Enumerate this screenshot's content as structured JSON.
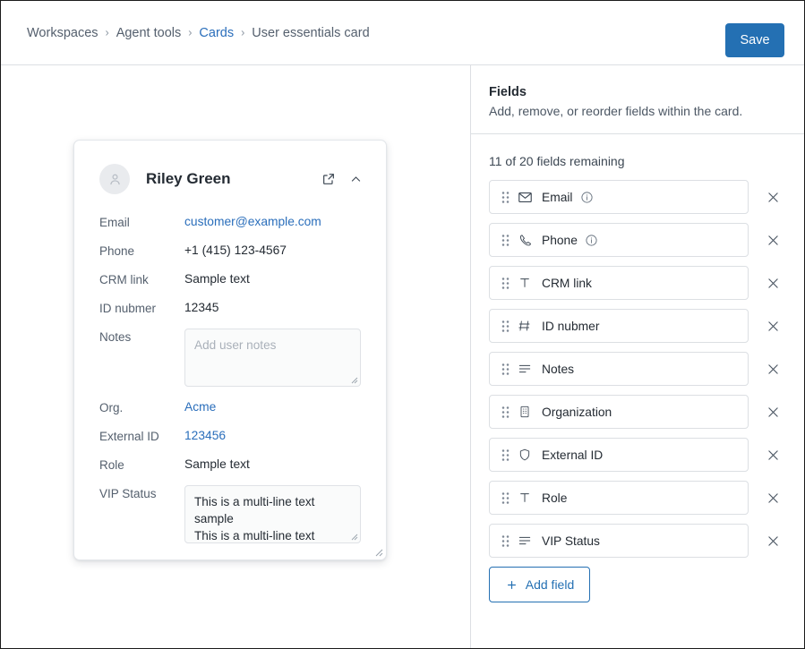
{
  "topbar": {
    "breadcrumb": [
      {
        "label": "Workspaces",
        "link": false
      },
      {
        "label": "Agent tools",
        "link": false
      },
      {
        "label": "Cards",
        "link": true
      },
      {
        "label": "User essentials card",
        "link": false
      }
    ],
    "separator": "›",
    "save_label": "Save"
  },
  "card": {
    "name": "Riley Green",
    "avatar_icon": "person-icon",
    "open_icon": "external-link-icon",
    "collapse_icon": "chevron-up-icon",
    "rows": [
      {
        "label": "Email",
        "value": "customer@example.com",
        "kind": "link"
      },
      {
        "label": "Phone",
        "value": "+1 (415) 123-4567",
        "kind": "text"
      },
      {
        "label": "CRM link",
        "value": "Sample text",
        "kind": "text"
      },
      {
        "label": "ID nubmer",
        "value": "12345",
        "kind": "text"
      },
      {
        "label": "Notes",
        "value": "",
        "kind": "textarea",
        "placeholder": "Add user notes"
      },
      {
        "label": "Org.",
        "value": "Acme",
        "kind": "link"
      },
      {
        "label": "External ID",
        "value": "123456",
        "kind": "link"
      },
      {
        "label": "Role",
        "value": "Sample text",
        "kind": "text"
      },
      {
        "label": "VIP Status",
        "value": "This is a multi-line text sample\nThis is a multi-line text",
        "kind": "textarea",
        "placeholder": ""
      }
    ]
  },
  "panel": {
    "title": "Fields",
    "subtitle": "Add, remove, or reorder fields within the card.",
    "remaining": "11 of 20 fields remaining",
    "drag_icon": "drag-handle-icon",
    "remove_icon": "close-icon",
    "info_icon": "info-icon",
    "add_field_label": "Add field",
    "add_icon": "plus-icon",
    "fields": [
      {
        "label": "Email",
        "icon": "envelope-icon",
        "info": true
      },
      {
        "label": "Phone",
        "icon": "phone-icon",
        "info": true
      },
      {
        "label": "CRM link",
        "icon": "text-type-icon",
        "info": false
      },
      {
        "label": "ID nubmer",
        "icon": "number-hash-icon",
        "info": false
      },
      {
        "label": "Notes",
        "icon": "multiline-text-icon",
        "info": false
      },
      {
        "label": "Organization",
        "icon": "building-icon",
        "info": false
      },
      {
        "label": "External ID",
        "icon": "shield-icon",
        "info": false
      },
      {
        "label": "Role",
        "icon": "text-type-icon",
        "info": false
      },
      {
        "label": "VIP Status",
        "icon": "multiline-text-icon",
        "info": false
      }
    ]
  },
  "colors": {
    "accent": "#2470b3",
    "link": "#2a6ebb",
    "text": "#242b33",
    "muted": "#55606e",
    "border": "#dcdfe3"
  }
}
